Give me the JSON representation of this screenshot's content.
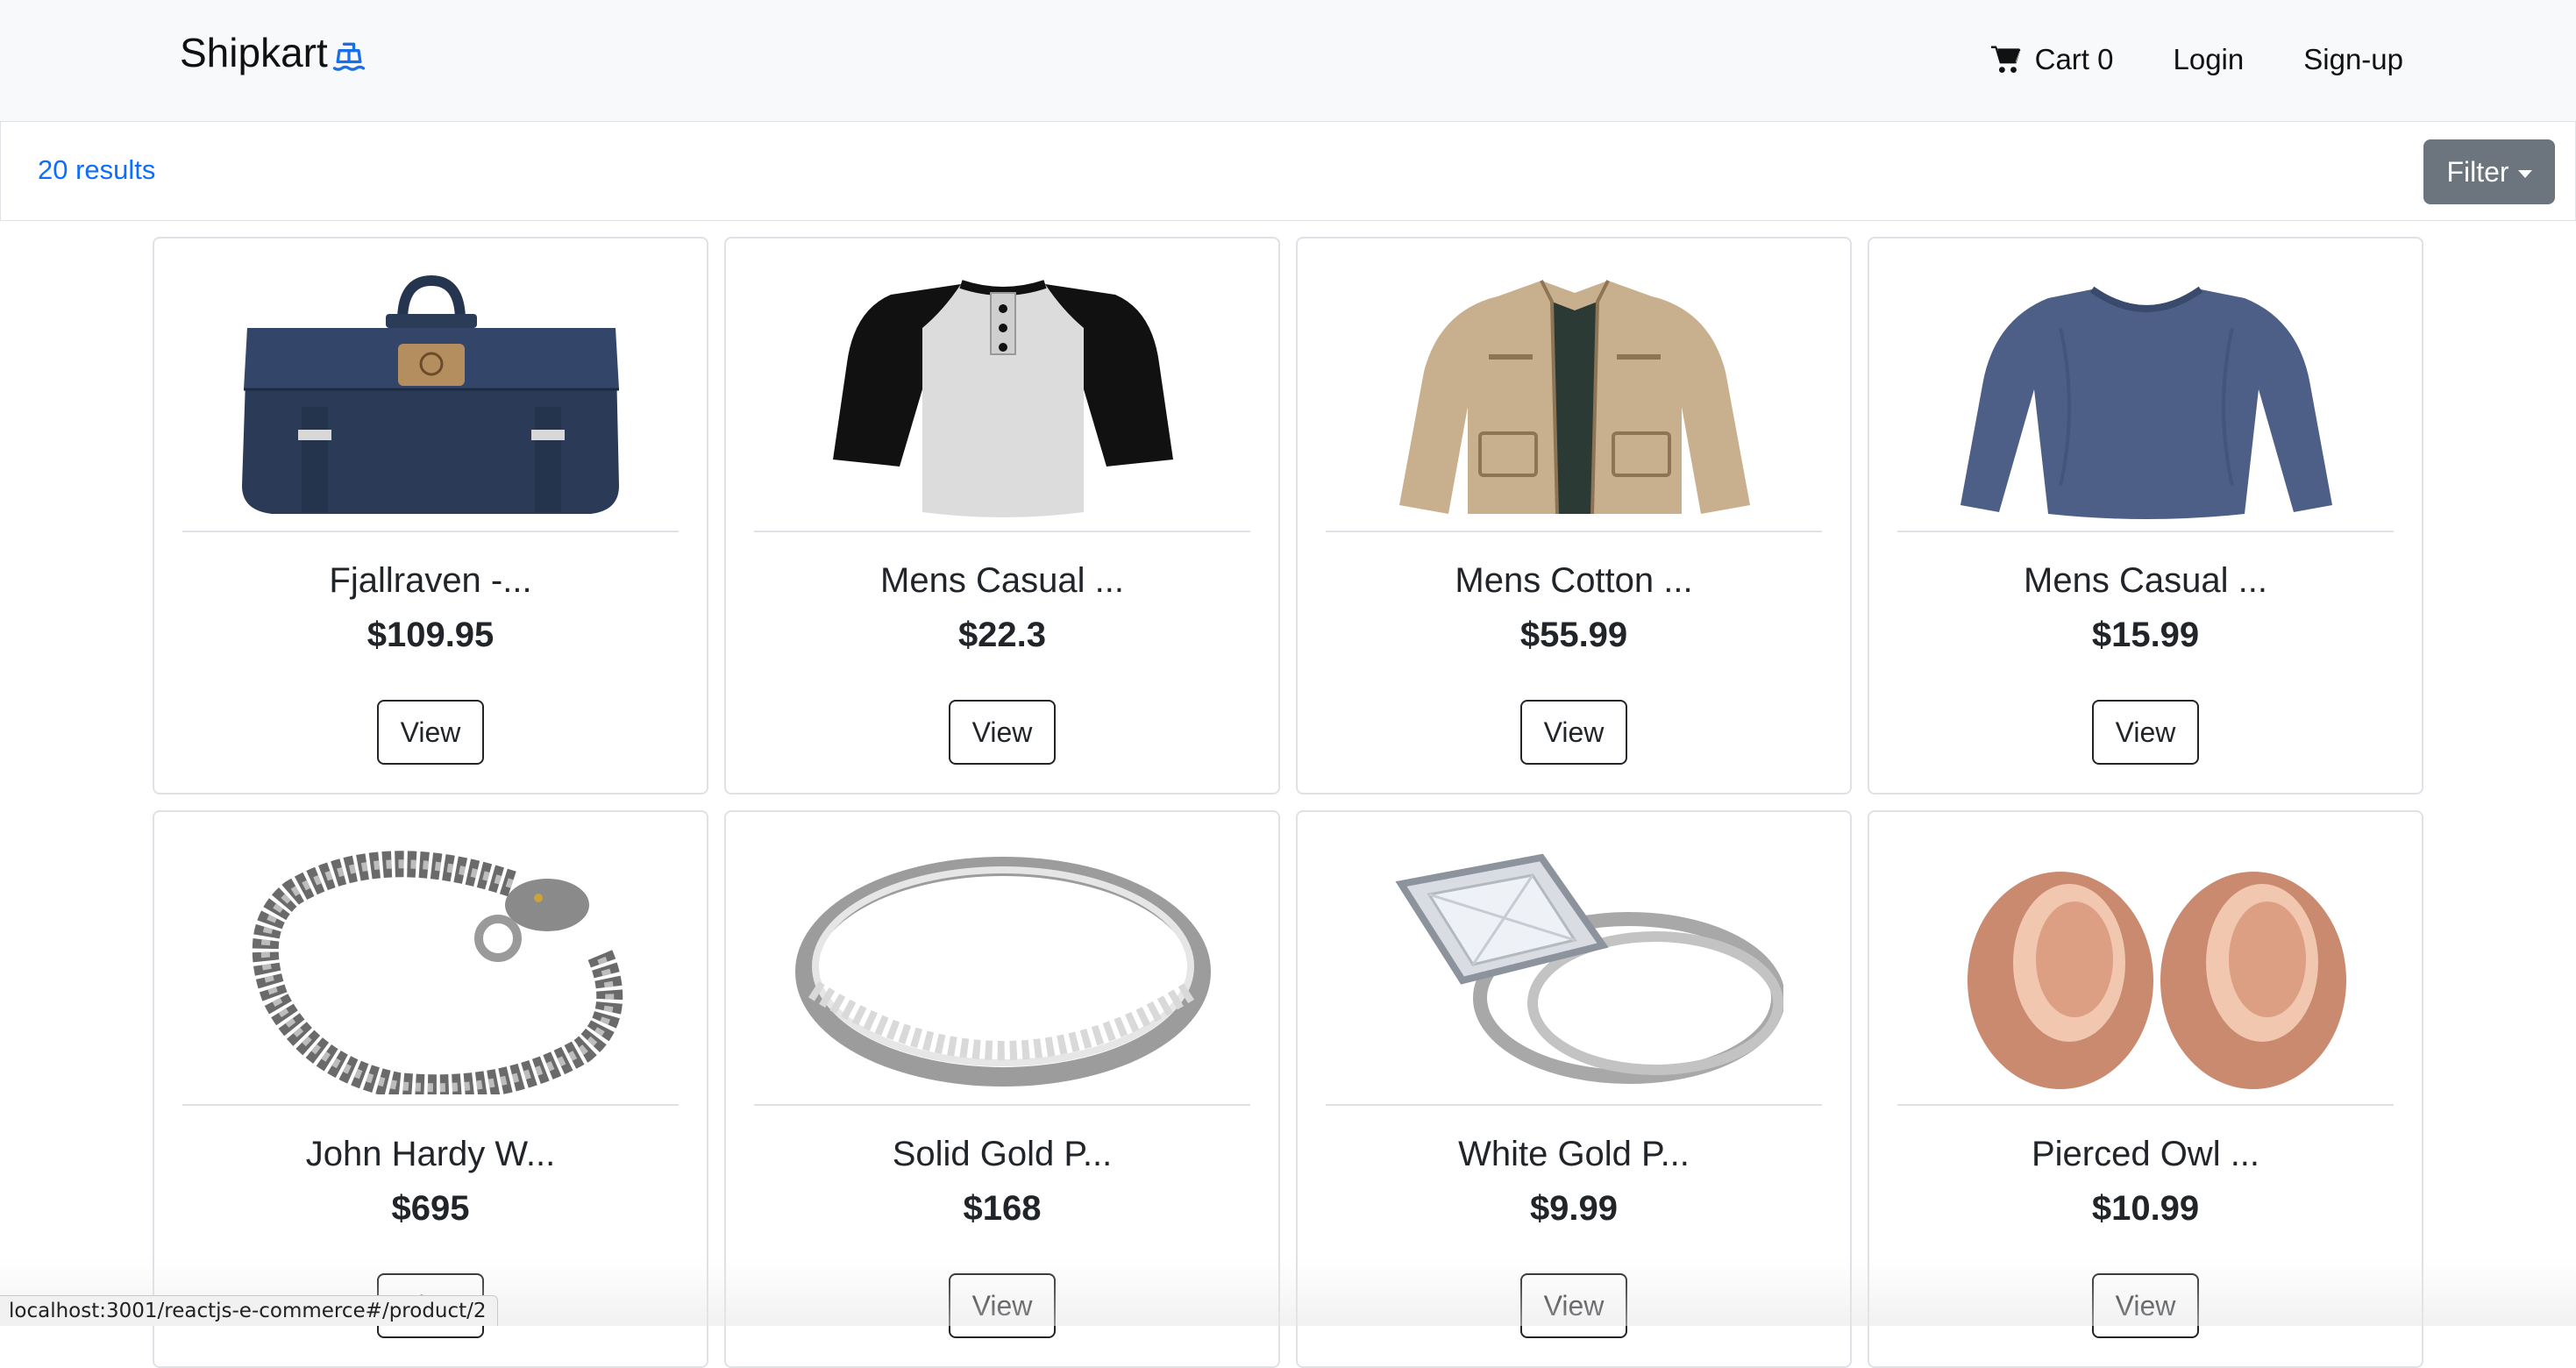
{
  "navbar": {
    "brand": "Shipkart",
    "brand_icon": "ship-icon",
    "cart_label": "Cart 0",
    "cart_icon": "cart-icon",
    "login_label": "Login",
    "signup_label": "Sign-up"
  },
  "results": {
    "count_text": "20 results",
    "filter_label": "Filter"
  },
  "products": [
    {
      "title": "Fjallraven -...",
      "price": "$109.95",
      "view_label": "View",
      "image": "backpack"
    },
    {
      "title": "Mens Casual ...",
      "price": "$22.3",
      "view_label": "View",
      "image": "raglan-tshirt"
    },
    {
      "title": "Mens Cotton ...",
      "price": "$55.99",
      "view_label": "View",
      "image": "cotton-jacket"
    },
    {
      "title": "Mens Casual ...",
      "price": "$15.99",
      "view_label": "View",
      "image": "longsleeve-shirt"
    },
    {
      "title": "John Hardy W...",
      "price": "$695",
      "view_label": "View",
      "image": "dragon-bracelet"
    },
    {
      "title": "Solid Gold P...",
      "price": "$168",
      "view_label": "View",
      "image": "silver-ring"
    },
    {
      "title": "White Gold P...",
      "price": "$9.99",
      "view_label": "View",
      "image": "diamond-ring-set"
    },
    {
      "title": "Pierced Owl ...",
      "price": "$10.99",
      "view_label": "View",
      "image": "rose-gold-plugs"
    }
  ],
  "status_bar": {
    "url": "localhost:3001/reactjs-e-commerce#/product/2"
  },
  "colors": {
    "navbar_bg": "#f8f9fa",
    "results_text": "#0d6efd",
    "filter_bg": "#6c757d",
    "border": "#dee2e6"
  }
}
